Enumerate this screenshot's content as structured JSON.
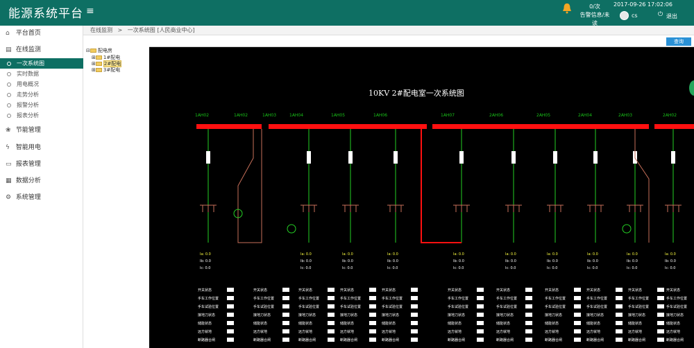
{
  "app": {
    "title": "能源系统平台",
    "menu_icon": "menu-icon",
    "alarm_line1": "0/次",
    "alarm_line2": "告警信息/未读",
    "datetime": "2017-09-26 17:02:06",
    "username": "cs",
    "logout": "退出"
  },
  "sidebar": {
    "items": [
      {
        "label": "平台首页",
        "icon": "home-icon"
      },
      {
        "label": "在线监测",
        "icon": "monitor-icon"
      }
    ],
    "subitems": [
      {
        "label": "一次系统图",
        "active": true
      },
      {
        "label": "实时数据",
        "active": false
      },
      {
        "label": "用电概况",
        "active": false
      },
      {
        "label": "走势分析",
        "active": false
      },
      {
        "label": "报警分析",
        "active": false
      },
      {
        "label": "报表分析",
        "active": false
      }
    ],
    "items2": [
      {
        "label": "节能管理",
        "icon": "leaf-icon"
      },
      {
        "label": "智能用电",
        "icon": "bolt-icon"
      },
      {
        "label": "报表管理",
        "icon": "report-icon"
      },
      {
        "label": "数据分析",
        "icon": "chart-icon"
      },
      {
        "label": "系统管理",
        "icon": "gear-icon"
      }
    ]
  },
  "breadcrumb": {
    "parent": "在线监测",
    "separator": ">",
    "current": "一次系统图 [人民商业中心]"
  },
  "tree": {
    "root": "配电房",
    "children": [
      "1#配电",
      "2#配电",
      "3#配电"
    ],
    "selected_index": 1
  },
  "toolbar": {
    "query_label": "查询"
  },
  "diagram": {
    "title": "10KV 2#配电室一次系统图",
    "cabinets": [
      "1AH02",
      "1AH02",
      "1AH03",
      "1AH04",
      "1AH05",
      "1AH06",
      "1AH07",
      "2AH06",
      "2AH05",
      "2AH04",
      "2AH03",
      "2AH02"
    ],
    "meter_lines": [
      "Ia: 0.0",
      "Ib: 0.0",
      "Ic: 0.0"
    ],
    "status_rows": [
      "开关状态",
      "手车工作位置",
      "手车试验位置",
      "接地刀状态",
      "储能状态",
      "远方就地",
      "断路器合闸"
    ],
    "colors": {
      "bus": "#ff1010",
      "feeder": "#24d024",
      "breaker": "#ffffff",
      "transformer_line": "#c8705a",
      "label": "#19c419"
    }
  }
}
